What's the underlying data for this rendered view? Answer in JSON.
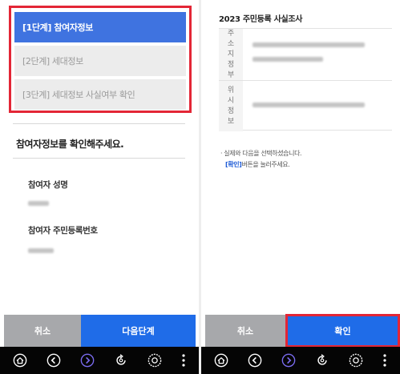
{
  "left": {
    "steps": [
      {
        "label": "[1단계] 참여자정보",
        "active": true
      },
      {
        "label": "[2단계] 세대정보",
        "active": false
      },
      {
        "label": "[3단계] 세대정보 사실여부 확인",
        "active": false
      }
    ],
    "section_title": "참여자정보를 확인해주세요.",
    "fields": [
      {
        "label": "참여자 성명"
      },
      {
        "label": "참여자 주민등록번호"
      }
    ],
    "buttons": {
      "cancel": "취소",
      "next": "다음단계"
    }
  },
  "right": {
    "title": "2023 주민등록 사실조사",
    "rows": [
      {
        "key_chars": [
          "주",
          "소",
          "지",
          "정",
          "부"
        ]
      },
      {
        "key_chars": [
          "위",
          "시",
          "정",
          "보"
        ]
      }
    ],
    "note_line1": "· 실제와 다음을 선택하셨습니다.",
    "note_highlight": "[확인]",
    "note_line2_rest": "버튼을 눌러주세요.",
    "buttons": {
      "cancel": "취소",
      "confirm": "확인"
    }
  },
  "colors": {
    "primary": "#1f6ce8",
    "step_active": "#3f73e0",
    "highlight_border": "#e32636",
    "cancel": "#a7a8ab",
    "navbar": "#050505"
  },
  "navbar_icons": [
    "home-icon",
    "back-icon",
    "forward-icon",
    "refresh-icon",
    "settings-icon",
    "more-icon"
  ]
}
